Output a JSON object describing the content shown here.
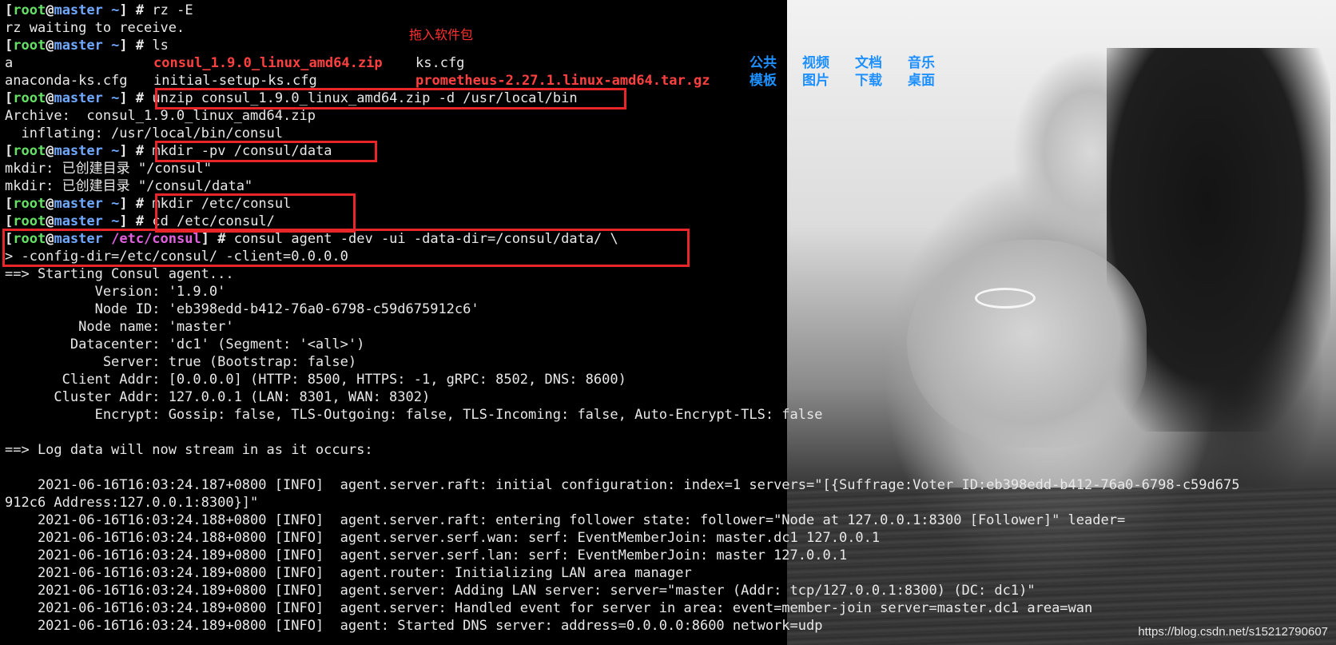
{
  "prompt": {
    "open": "[",
    "user": "root",
    "at": "@",
    "host": "master",
    "home": "~",
    "etc_dir": "/etc/consul",
    "close": "]",
    "hash": "#"
  },
  "commands": {
    "rz": "rz -E",
    "ls": "ls",
    "unzip": "unzip consul_1.9.0_linux_amd64.zip -d /usr/local/bin",
    "mkdir_data": "mkdir -pv /consul/data",
    "mkdir_etc": "mkdir /etc/consul",
    "cd": "cd /etc/consul/",
    "agent_1": "consul agent -dev -ui -data-dir=/consul/data/ \\",
    "agent_2": "> -config-dir=/etc/consul/ -client=0.0.0.0"
  },
  "annotation": "拖入软件包",
  "output": {
    "rz_wait": "rz waiting to receive.",
    "ls_items": {
      "a": "a",
      "consul_zip": "consul_1.9.0_linux_amd64.zip",
      "ks": "ks.cfg",
      "anaconda": "anaconda-ks.cfg",
      "initial": "initial-setup-ks.cfg",
      "prometheus": "prometheus-2.27.1.linux-amd64.tar.gz",
      "dirs_row1": [
        "公共",
        "视频",
        "文档",
        "音乐"
      ],
      "dirs_row2": [
        "模板",
        "图片",
        "下载",
        "桌面"
      ]
    },
    "archive": "Archive:  consul_1.9.0_linux_amd64.zip",
    "inflating": "  inflating: /usr/local/bin/consul",
    "mkdir_1": "mkdir: 已创建目录 \"/consul\"",
    "mkdir_2": "mkdir: 已创建目录 \"/consul/data\"",
    "starting": "==> Starting Consul agent...",
    "version": "           Version: '1.9.0'",
    "node_id": "           Node ID: 'eb398edd-b412-76a0-6798-c59d675912c6'",
    "node_name": "         Node name: 'master'",
    "datacenter": "        Datacenter: 'dc1' (Segment: '<all>')",
    "server": "            Server: true (Bootstrap: false)",
    "client_addr": "       Client Addr: [0.0.0.0] (HTTP: 8500, HTTPS: -1, gRPC: 8502, DNS: 8600)",
    "cluster_addr": "      Cluster Addr: 127.0.0.1 (LAN: 8301, WAN: 8302)",
    "encrypt": "           Encrypt: Gossip: false, TLS-Outgoing: false, TLS-Incoming: false, Auto-Encrypt-TLS: false",
    "log_stream": "==> Log data will now stream in as it occurs:",
    "logs": [
      "    2021-06-16T16:03:24.187+0800 [INFO]  agent.server.raft: initial configuration: index=1 servers=\"[{Suffrage:Voter ID:eb398edd-b412-76a0-6798-c59d675",
      "912c6 Address:127.0.0.1:8300}]\"",
      "    2021-06-16T16:03:24.188+0800 [INFO]  agent.server.raft: entering follower state: follower=\"Node at 127.0.0.1:8300 [Follower]\" leader=",
      "    2021-06-16T16:03:24.188+0800 [INFO]  agent.server.serf.wan: serf: EventMemberJoin: master.dc1 127.0.0.1",
      "    2021-06-16T16:03:24.189+0800 [INFO]  agent.server.serf.lan: serf: EventMemberJoin: master 127.0.0.1",
      "    2021-06-16T16:03:24.189+0800 [INFO]  agent.router: Initializing LAN area manager",
      "    2021-06-16T16:03:24.189+0800 [INFO]  agent.server: Adding LAN server: server=\"master (Addr: tcp/127.0.0.1:8300) (DC: dc1)\"",
      "    2021-06-16T16:03:24.189+0800 [INFO]  agent.server: Handled event for server in area: event=member-join server=master.dc1 area=wan",
      "    2021-06-16T16:03:24.189+0800 [INFO]  agent: Started DNS server: address=0.0.0.0:8600 network=udp"
    ]
  },
  "watermark": "https://blog.csdn.net/s15212790607",
  "colors": {
    "prompt_user": "#66e066",
    "prompt_host": "#6fa8ff",
    "prompt_dir": "#e060e0",
    "archive_file": "#ff4040",
    "directory": "#1e90ff",
    "highlight_box": "#e8262a"
  }
}
